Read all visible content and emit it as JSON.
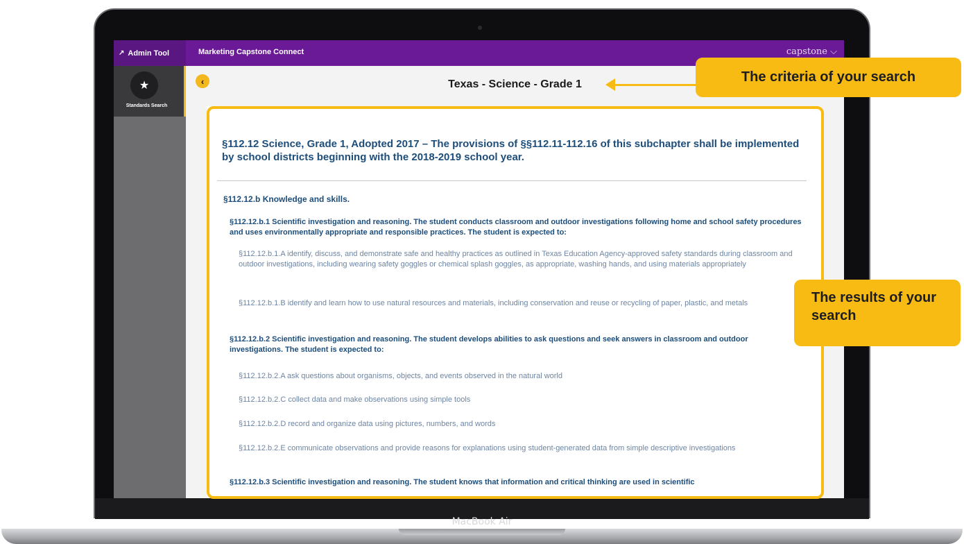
{
  "app": {
    "admin_tool_label": "Admin Tool",
    "admin_icon": "chart-icon",
    "title": "Marketing Capstone Connect",
    "brand": "capstone",
    "brand_color": "#6a1a96"
  },
  "sidebar": {
    "items": [
      {
        "label": "Standards Search",
        "icon": "star-search-icon",
        "active": true
      }
    ]
  },
  "header": {
    "back_icon": "chevron-left-icon",
    "criteria": "Texas - Science - Grade 1"
  },
  "results": {
    "title": "§112.12 Science, Grade 1, Adopted 2017 – The provisions of §§112.11-112.16 of this subchapter shall be implemented by school districts beginning with the 2018-2019 school year.",
    "entries": [
      {
        "level": 1,
        "text": "§112.12.b Knowledge and skills."
      },
      {
        "level": 2,
        "text": "§112.12.b.1 Scientific investigation and reasoning. The student conducts classroom and outdoor investigations following home and school safety procedures and uses environmentally appropriate and responsible practices. The student is expected to:"
      },
      {
        "level": 3,
        "text": "§112.12.b.1.A identify, discuss, and demonstrate safe and healthy practices as outlined in Texas Education Agency-approved safety standards during classroom and outdoor investigations, including wearing safety goggles or chemical splash goggles, as appropriate, washing hands, and using materials appropriately"
      },
      {
        "level": 3,
        "text": "§112.12.b.1.B identify and learn how to use natural resources and materials, including conservation and reuse or recycling of paper, plastic, and metals"
      },
      {
        "level": 2,
        "text": "§112.12.b.2 Scientific investigation and reasoning. The student develops abilities to ask questions and seek answers in classroom and outdoor investigations. The student is expected to:"
      },
      {
        "level": 3,
        "text": "§112.12.b.2.A ask questions about organisms, objects, and events observed in the natural world"
      },
      {
        "level": 3,
        "text": "§112.12.b.2.C collect data and make observations using simple tools"
      },
      {
        "level": 3,
        "text": "§112.12.b.2.D record and organize data using pictures, numbers, and words"
      },
      {
        "level": 3,
        "text": "§112.12.b.2.E communicate observations and provide reasons for explanations using student-generated data from simple descriptive investigations"
      },
      {
        "level": 2,
        "text": "§112.12.b.3 Scientific investigation and reasoning. The student knows that information and critical thinking are used in scientific"
      }
    ]
  },
  "annotations": {
    "criteria_callout": "The criteria of your search",
    "results_callout": "The results of your search",
    "accent_color": "#f7bb14"
  },
  "device": {
    "label": "MacBook Air"
  }
}
